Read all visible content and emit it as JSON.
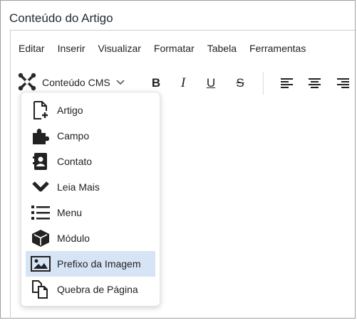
{
  "panel": {
    "title": "Conteúdo do Artigo"
  },
  "menubar": {
    "items": [
      "Editar",
      "Inserir",
      "Visualizar",
      "Formatar",
      "Tabela",
      "Ferramentas"
    ]
  },
  "toolbar": {
    "cms_label": "Conteúdo CMS",
    "bold": "B",
    "italic": "I",
    "underline": "U",
    "strike": "S"
  },
  "dropdown": {
    "items": [
      {
        "label": "Artigo",
        "icon": "file-plus-icon"
      },
      {
        "label": "Campo",
        "icon": "puzzle-icon"
      },
      {
        "label": "Contato",
        "icon": "contact-book-icon"
      },
      {
        "label": "Leia Mais",
        "icon": "chevron-down-icon"
      },
      {
        "label": "Menu",
        "icon": "list-icon"
      },
      {
        "label": "Módulo",
        "icon": "cube-icon"
      },
      {
        "label": "Prefixo da Imagem",
        "icon": "image-icon",
        "selected": true
      },
      {
        "label": "Quebra de Página",
        "icon": "copy-icon"
      }
    ],
    "selected_color": "#d6e4f5"
  }
}
